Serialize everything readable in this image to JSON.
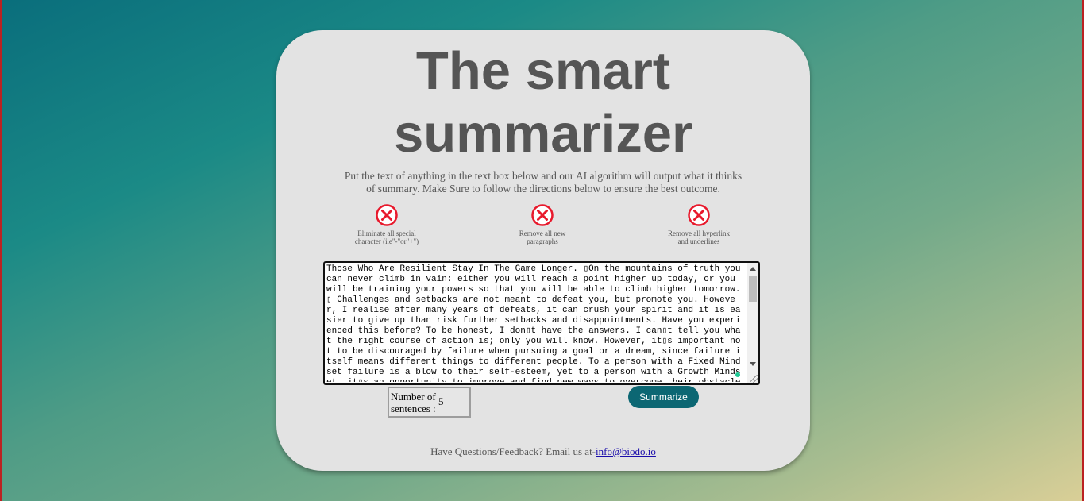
{
  "page": {
    "title_line1": "The smart",
    "title_line2": "summarizer",
    "subtitle": "Put the text of anything in the text box below and our AI algorithm will output what it thinks of summary. Make Sure to follow the directions below to ensure the best outcome."
  },
  "rules": [
    {
      "icon": "x-circle-icon",
      "text": "Eliminate all special character (i.e\"-\"or\"+\")"
    },
    {
      "icon": "x-circle-icon",
      "text": "Remove all new paragraphs"
    },
    {
      "icon": "x-circle-icon",
      "text": "Remove all hyperlink and underlines"
    }
  ],
  "textarea": {
    "value": "Those Who Are Resilient Stay In The Game Longer. ▯On the mountains of truth you can never climb in vain: either you will reach a point higher up today, or you will be training your powers so that you will be able to climb higher tomorrow.▯ Challenges and setbacks are not meant to defeat you, but promote you. However, I realise after many years of defeats, it can crush your spirit and it is easier to give up than risk further setbacks and disappointments. Have you experienced this before? To be honest, I don▯t have the answers. I can▯t tell you what the right course of action is; only you will know. However, it▯s important not to be discouraged by failure when pursuing a goal or a dream, since failure itself means different things to different people. To a person with a Fixed Mindset failure is a blow to their self-esteem, yet to a person with a Growth Mindset, it▯s an opportunity to improve and find new ways to overcome their obstacles. Some"
  },
  "controls": {
    "sentences_label": "Number of sentences :",
    "sentences_value": "5",
    "summarize_label": "Summarize"
  },
  "footer": {
    "text": "Have Questions/Feedback? Email us at-",
    "email": "info@biodo.io"
  },
  "colors": {
    "card": "#e3e3e3",
    "button": "#0c6773",
    "icon_red": "#e8192c"
  }
}
